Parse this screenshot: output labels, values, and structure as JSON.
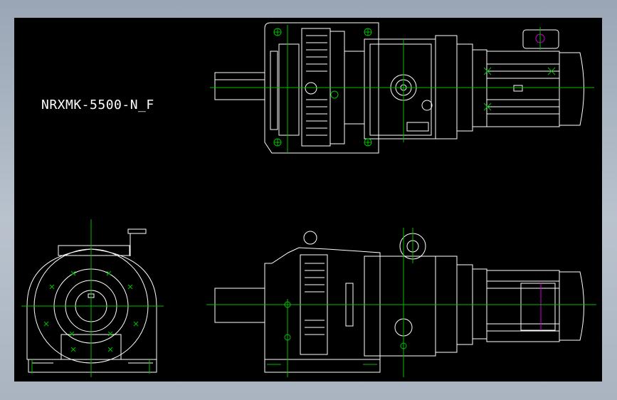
{
  "drawing": {
    "title": "NRXMK-5500-N_F",
    "views": [
      "top-view",
      "end-view",
      "front-view"
    ]
  },
  "colors": {
    "background": "#000000",
    "frame": "#9aa6b6",
    "outline": "#ffffff",
    "centerline": "#00c000",
    "hatch": "#00ff00",
    "highlight": "#d000d0"
  }
}
